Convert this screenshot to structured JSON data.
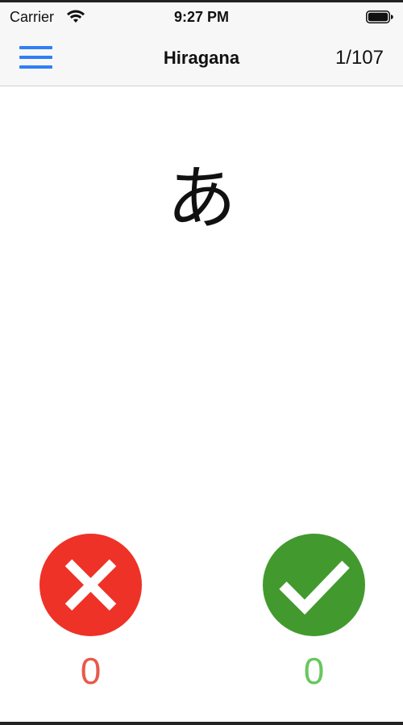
{
  "status_bar": {
    "carrier": "Carrier",
    "time": "9:27 PM"
  },
  "nav": {
    "title": "Hiragana",
    "progress": "1/107",
    "menu_icon": "hamburger-menu-icon"
  },
  "card": {
    "character": "あ"
  },
  "answers": {
    "wrong_count": "0",
    "right_count": "0",
    "wrong_icon": "close-icon",
    "right_icon": "checkmark-icon"
  },
  "colors": {
    "accent": "#2f7ff5",
    "wrong": "#ee3227",
    "right": "#429a2f",
    "wrong_text": "#e9594b",
    "right_text": "#68c760"
  }
}
